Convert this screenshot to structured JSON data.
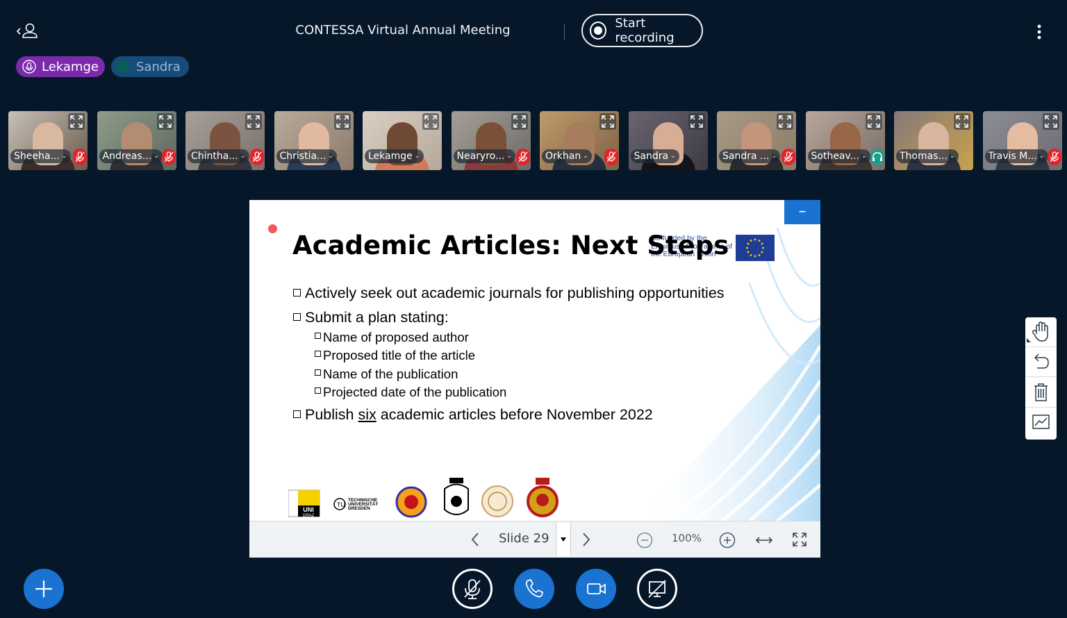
{
  "topbar": {
    "meeting_title": "CONTESSA Virtual Annual Meeting",
    "record_label": "Start recording"
  },
  "talkers": [
    {
      "name": "Lekamge"
    },
    {
      "name": "Sandra"
    }
  ],
  "participants": [
    {
      "name": "Sheeha...",
      "status": "muted"
    },
    {
      "name": "Andreas...",
      "status": "muted"
    },
    {
      "name": "Chintha...",
      "status": "muted"
    },
    {
      "name": "Christia...",
      "status": "none"
    },
    {
      "name": "Lekamge",
      "status": "none"
    },
    {
      "name": "Nearyro...",
      "status": "muted"
    },
    {
      "name": "Orkhan",
      "status": "muted"
    },
    {
      "name": "Sandra",
      "status": "none"
    },
    {
      "name": "Sandra ...",
      "status": "muted"
    },
    {
      "name": "Sotheav...",
      "status": "listen-only"
    },
    {
      "name": "Thomas...",
      "status": "none"
    },
    {
      "name": "Travis M...",
      "status": "muted"
    }
  ],
  "slide": {
    "title": "Academic Articles: Next Steps",
    "eu_funding": "Co-funded by the Erasmus+ Programme of the European Union",
    "bullets": {
      "b1": "Actively seek out academic journals for publishing opportunities",
      "b2": "Submit a plan stating:",
      "b2_sub": [
        "Name of proposed author",
        "Proposed title of the article",
        "Name of the publication",
        "Projected date of the publication"
      ],
      "b3_pre": "Publish ",
      "b3_em": "six",
      "b3_post": " academic articles before November 2022"
    },
    "logos": {
      "uni_graz": "UNI GRAZ",
      "tu_dresden": "TECHNISCHE UNIVERSITÄT DRESDEN"
    }
  },
  "presentation_controls": {
    "slide_label": "Slide 29",
    "zoom": "100%"
  },
  "colors": {
    "background": "#06172a",
    "primary": "#1a73d1",
    "talker_active": "#7b2aab",
    "muted": "#e0242a"
  }
}
